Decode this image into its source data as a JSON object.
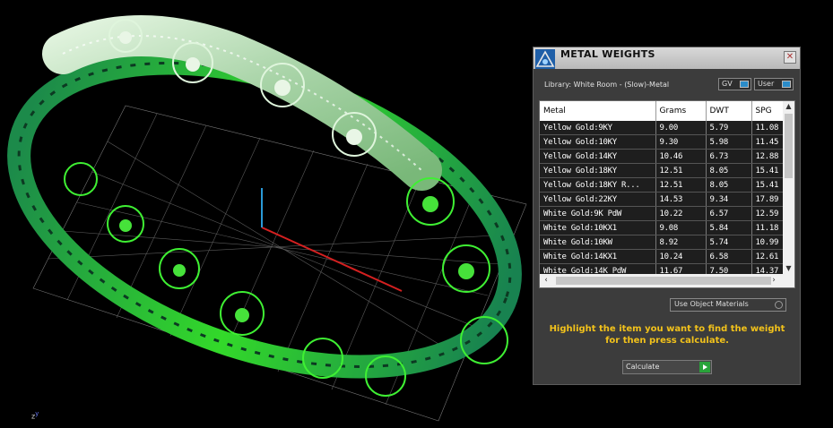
{
  "viewport": {
    "axis_z": "z",
    "axis_y": "y",
    "model": "filigree-bangle"
  },
  "panel": {
    "title": "METAL WEIGHTS",
    "close_symbol": "✕",
    "library": "Library: White Room - (Slow)-Metal",
    "toggle_gv": "GV",
    "toggle_user": "User",
    "columns": [
      "Metal",
      "Grams",
      "DWT",
      "SPG"
    ],
    "rows": [
      [
        "Yellow Gold:9KY",
        "9.00",
        "5.79",
        "11.08"
      ],
      [
        "Yellow Gold:10KY",
        "9.30",
        "5.98",
        "11.45"
      ],
      [
        "Yellow Gold:14KY",
        "10.46",
        "6.73",
        "12.88"
      ],
      [
        "Yellow Gold:18KY",
        "12.51",
        "8.05",
        "15.41"
      ],
      [
        "Yellow Gold:18KY R...",
        "12.51",
        "8.05",
        "15.41"
      ],
      [
        "Yellow Gold:22KY",
        "14.53",
        "9.34",
        "17.89"
      ],
      [
        "White Gold:9K PdW",
        "10.22",
        "6.57",
        "12.59"
      ],
      [
        "White Gold:10KX1",
        "9.08",
        "5.84",
        "11.18"
      ],
      [
        "White Gold:10KW",
        "8.92",
        "5.74",
        "10.99"
      ],
      [
        "White Gold:14KX1",
        "10.24",
        "6.58",
        "12.61"
      ],
      [
        "White Gold:14K PdW",
        "11.67",
        "7.50",
        "14.37"
      ]
    ],
    "use_object_materials": "Use Object Materials",
    "hint": "Highlight the item you want to find the weight for then press calculate.",
    "calculate": "Calculate",
    "accent_color": "#f2c21b",
    "play_color": "#29a33a"
  }
}
